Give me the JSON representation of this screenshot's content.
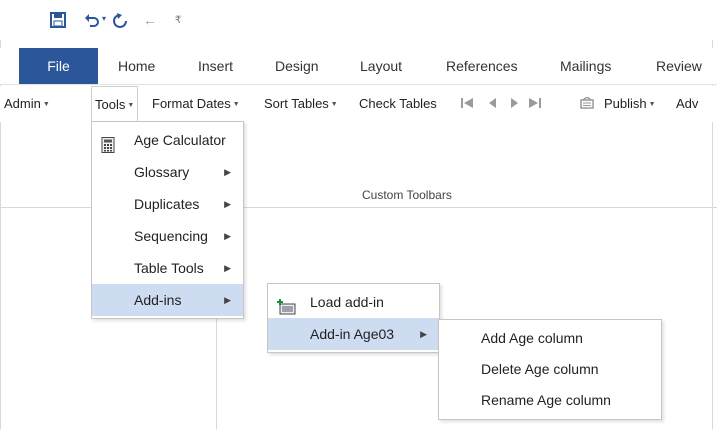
{
  "qat": {
    "save_icon": "save-icon",
    "undo_icon": "undo-icon",
    "redo_icon": "redo-icon",
    "back_icon": "back-arrow-icon",
    "customize_icon": "customize-qat-icon"
  },
  "tabs": [
    {
      "label": "File"
    },
    {
      "label": "Home"
    },
    {
      "label": "Insert"
    },
    {
      "label": "Design"
    },
    {
      "label": "Layout"
    },
    {
      "label": "References"
    },
    {
      "label": "Mailings"
    },
    {
      "label": "Review"
    }
  ],
  "toolbar": {
    "admin": "Admin",
    "tools": "Tools",
    "format_dates": "Format Dates",
    "sort_tables": "Sort Tables",
    "check_tables": "Check Tables",
    "publish": "Publish",
    "adv": "Adv",
    "group_label": "Custom Toolbars"
  },
  "tools_menu": [
    {
      "label": "Age Calculator",
      "icon": "calculator-icon"
    },
    {
      "label": "Glossary"
    },
    {
      "label": "Duplicates"
    },
    {
      "label": "Sequencing"
    },
    {
      "label": "Table Tools"
    },
    {
      "label": "Add-ins"
    }
  ],
  "addins_menu": [
    {
      "label": "Load add-in",
      "icon": "load-addin-icon"
    },
    {
      "label": "Add-in Age03"
    }
  ],
  "age03_menu": [
    {
      "label": "Add Age column"
    },
    {
      "label": "Delete Age column"
    },
    {
      "label": "Rename Age column"
    }
  ],
  "colors": {
    "accent": "#2b579a",
    "highlight": "#cddcf0"
  }
}
